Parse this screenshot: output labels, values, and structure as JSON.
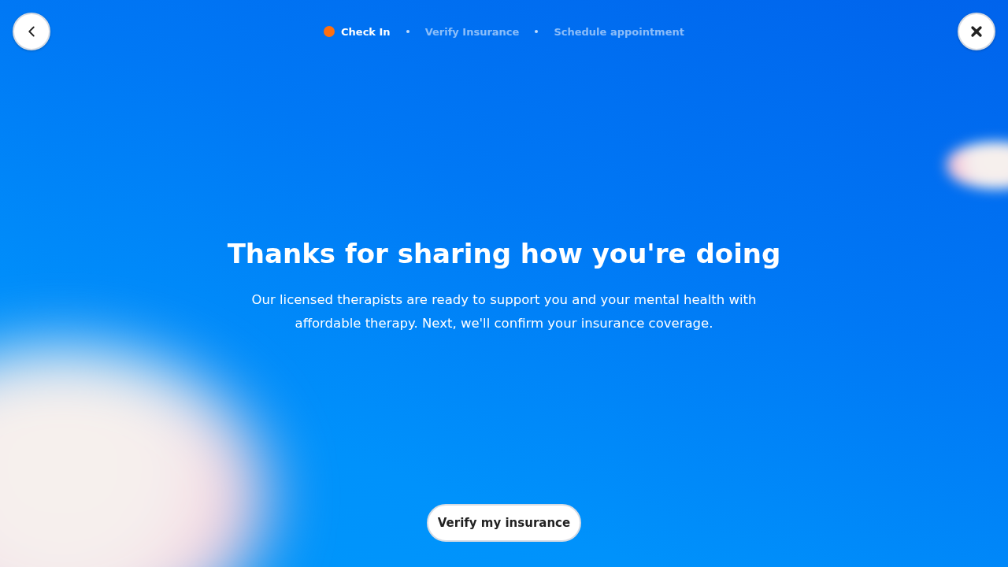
{
  "steps": [
    {
      "label": "Check In",
      "selected": true
    },
    {
      "label": "Verify Insurance",
      "selected": false
    },
    {
      "label": "Schedule appointment",
      "selected": false
    }
  ],
  "heading": "Thanks for sharing how you're doing",
  "body": "Our licensed therapists are ready to support you and your mental health with affordable therapy. Next, we'll confirm your insurance coverage.",
  "cta": "Verify my insurance"
}
